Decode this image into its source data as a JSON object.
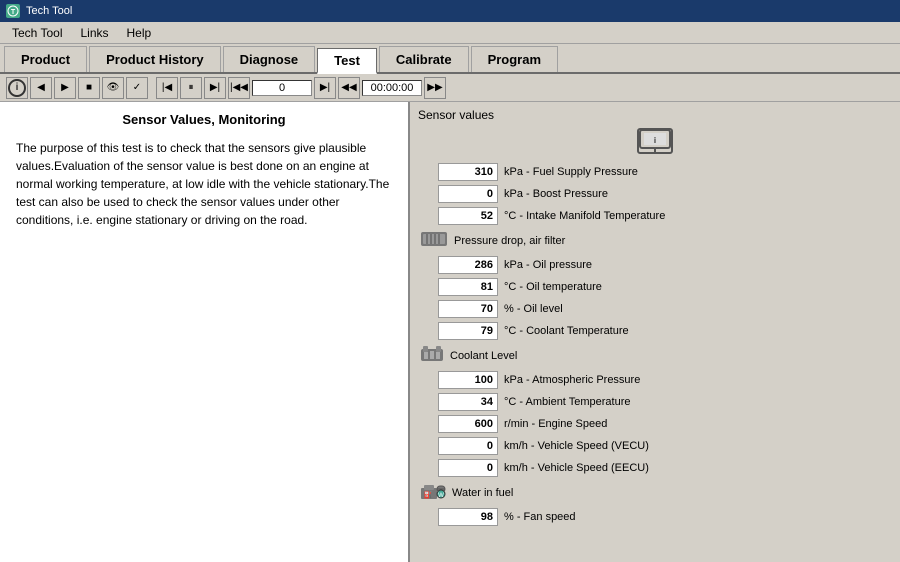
{
  "app": {
    "title": "Tech Tool",
    "title_icon": "T"
  },
  "menubar": {
    "items": [
      {
        "label": "Tech Tool"
      },
      {
        "label": "Links"
      },
      {
        "label": "Help"
      }
    ]
  },
  "nav_tabs": [
    {
      "label": "Product",
      "active": false
    },
    {
      "label": "Product History",
      "active": false
    },
    {
      "label": "Diagnose",
      "active": false
    },
    {
      "label": "Test",
      "active": true
    },
    {
      "label": "Calibrate",
      "active": false
    },
    {
      "label": "Program",
      "active": false
    }
  ],
  "toolbar": {
    "time": "00:00:00"
  },
  "left_panel": {
    "title": "Sensor Values, Monitoring",
    "description": "The purpose of this test is to check that the sensors give plausible values.Evaluation of the sensor value is best done on an engine at normal working temperature, at low idle with the vehicle stationary.The test can also be used to check the sensor values under other conditions, i.e. engine stationary or driving on the road."
  },
  "right_panel": {
    "title": "Sensor values",
    "sensor_groups": [
      {
        "type": "icon_row",
        "icon_type": "monitor"
      },
      {
        "type": "value",
        "value": "310",
        "label": "kPa - Fuel Supply Pressure"
      },
      {
        "type": "value",
        "value": "0",
        "label": "kPa - Boost Pressure"
      },
      {
        "type": "value",
        "value": "52",
        "label": "°C - Intake Manifold Temperature"
      },
      {
        "type": "section",
        "icon_type": "filter",
        "label": "Pressure drop, air filter"
      },
      {
        "type": "value",
        "value": "286",
        "label": "kPa - Oil pressure"
      },
      {
        "type": "value",
        "value": "81",
        "label": "°C - Oil temperature"
      },
      {
        "type": "value",
        "value": "70",
        "label": "% - Oil level"
      },
      {
        "type": "value",
        "value": "79",
        "label": "°C - Coolant Temperature"
      },
      {
        "type": "section",
        "icon_type": "coolant",
        "label": "Coolant Level"
      },
      {
        "type": "value",
        "value": "100",
        "label": "kPa - Atmospheric Pressure"
      },
      {
        "type": "value",
        "value": "34",
        "label": "°C - Ambient Temperature"
      },
      {
        "type": "value",
        "value": "600",
        "label": "r/min - Engine Speed"
      },
      {
        "type": "value",
        "value": "0",
        "label": "km/h - Vehicle Speed (VECU)"
      },
      {
        "type": "value",
        "value": "0",
        "label": "km/h - Vehicle Speed (EECU)"
      },
      {
        "type": "section",
        "icon_type": "fuel",
        "label": "Water in fuel"
      },
      {
        "type": "value",
        "value": "98",
        "label": "% - Fan speed"
      }
    ]
  }
}
